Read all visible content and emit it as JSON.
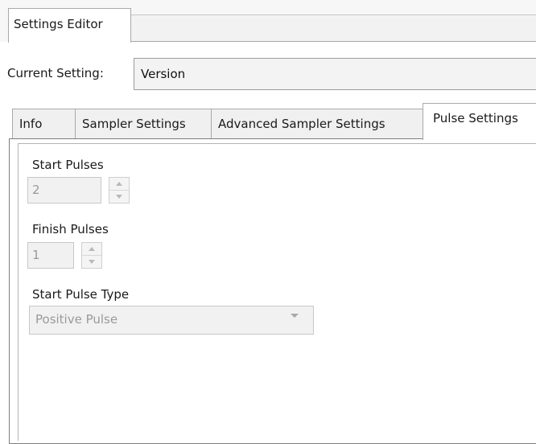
{
  "window": {
    "editor_tab_label": "Settings Editor"
  },
  "current_setting": {
    "label": "Current Setting:",
    "value": "Version"
  },
  "tabs": [
    {
      "label": "Info",
      "active": false
    },
    {
      "label": "Sampler Settings",
      "active": false
    },
    {
      "label": "Advanced Sampler Settings",
      "active": false
    },
    {
      "label": "Pulse Settings",
      "active": true
    }
  ],
  "pulse_settings": {
    "start_pulses_label": "Start Pulses",
    "start_pulses_value": "2",
    "finish_pulses_label": "Finish Pulses",
    "finish_pulses_value": "1",
    "start_pulse_type_label": "Start Pulse Type",
    "start_pulse_type_value": "Positive Pulse",
    "disabled": true
  },
  "icons": {
    "spin_up": "chevron-up-icon",
    "spin_down": "chevron-down-icon",
    "dropdown": "caret-down-icon"
  },
  "colors": {
    "disabled_text": "#9a9a9a",
    "border": "#a9a9a9",
    "background": "#ffffff"
  }
}
